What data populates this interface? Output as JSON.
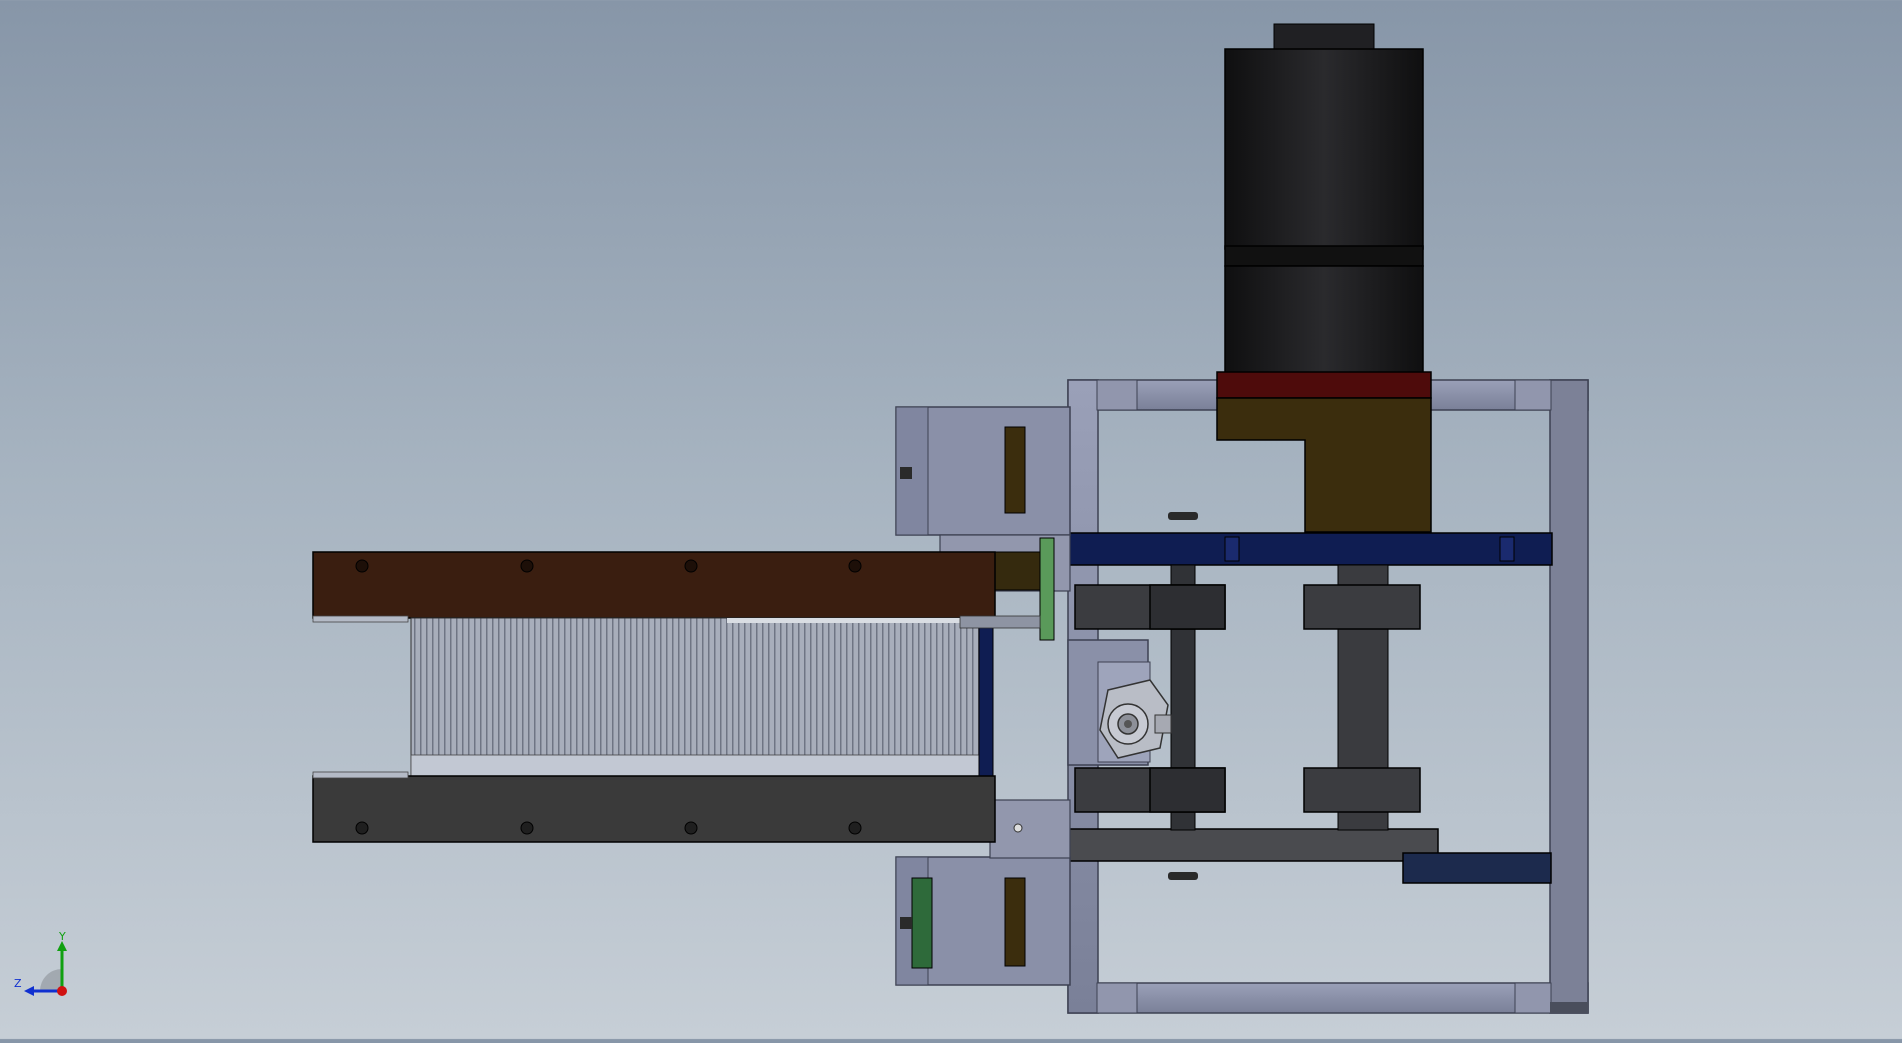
{
  "triad": {
    "y_label": "Y",
    "z_label": "Z"
  },
  "colors": {
    "background_top": "#8796a8",
    "background_bottom": "#c6ced6",
    "frame": "#8a90a8",
    "frame_dark": "#5b6075",
    "motor": "#1a1a1c",
    "motor_band_red": "#5a0a0a",
    "gearbox": "#3b2d0d",
    "rail_blue": "#0f1d52",
    "plate_brown": "#3a1e10",
    "plate_dark": "#3a3a3a",
    "belt_gray": "#9097a5",
    "bracket_green": "#2e6a3a",
    "axis_x": "#d01010",
    "axis_y": "#10a010",
    "axis_z": "#1030d0"
  }
}
